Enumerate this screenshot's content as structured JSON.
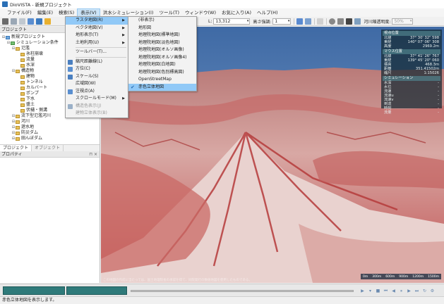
{
  "window": {
    "title": "DioVISTA - 新規プロジェクト"
  },
  "menubar": [
    {
      "label": "ファイル(F)"
    },
    {
      "label": "編集(E)"
    },
    {
      "label": "検索(S)"
    },
    {
      "label": "表示(V)"
    },
    {
      "label": "洪水シミュレーション(I)"
    },
    {
      "label": "ツール(T)"
    },
    {
      "label": "ウィンドウ(W)"
    },
    {
      "label": "お気に入り(A)"
    },
    {
      "label": "ヘルプ(H)"
    }
  ],
  "toolbar": {
    "l_label": "L:",
    "l_value": "13,312",
    "height_label": "高さ強調:",
    "height_value": "1",
    "transparency_label": "河川縮透明度:",
    "transparency_value": "50%"
  },
  "project_panel": {
    "title": "プロジェクト",
    "tree": [
      {
        "label": "新規プロジェクト",
        "level": 0,
        "kind": "proj"
      },
      {
        "label": "シミュレーション条件",
        "level": 1,
        "kind": "sim"
      },
      {
        "label": "氾濫",
        "level": 2,
        "kind": "folder"
      },
      {
        "label": "氷柱崩壊",
        "level": 3,
        "kind": "folder"
      },
      {
        "label": "流量",
        "level": 3,
        "kind": "folder"
      },
      {
        "label": "水深",
        "level": 3,
        "kind": "folder"
      },
      {
        "label": "構造物",
        "level": 2,
        "kind": "folder"
      },
      {
        "label": "建物",
        "level": 3,
        "kind": "folder"
      },
      {
        "label": "トンネル",
        "level": 3,
        "kind": "folder"
      },
      {
        "label": "カルバート",
        "level": 3,
        "kind": "folder"
      },
      {
        "label": "ポンプ",
        "level": 3,
        "kind": "folder"
      },
      {
        "label": "下水",
        "level": 3,
        "kind": "folder"
      },
      {
        "label": "盛土",
        "level": 3,
        "kind": "folder"
      },
      {
        "label": "伏樋・側溝",
        "level": 3,
        "kind": "folder"
      },
      {
        "label": "流下型氾濫河川",
        "level": 2,
        "kind": "folder"
      },
      {
        "label": "河川",
        "level": 2,
        "kind": "folder"
      },
      {
        "label": "遊水地",
        "level": 2,
        "kind": "folder"
      },
      {
        "label": "防災ダム",
        "level": 2,
        "kind": "folder"
      },
      {
        "label": "田んぼダム",
        "level": 2,
        "kind": "folder"
      }
    ]
  },
  "panel_tabs": [
    {
      "label": "プロジェクト"
    },
    {
      "label": "オブジェクト"
    }
  ],
  "property_panel": {
    "title": "プロパティ"
  },
  "view_menu": [
    {
      "label": "ラスタ地図(R)",
      "has_sub": true,
      "highlight": true
    },
    {
      "label": "ベクタ地図(V)",
      "has_sub": true
    },
    {
      "label": "地形表示(T)",
      "has_sub": true
    },
    {
      "label": "土地利用(U)",
      "has_sub": true
    },
    {
      "sep": true
    },
    {
      "label": "ツールバー(T)..."
    },
    {
      "sep": true
    },
    {
      "label": "縮尺距離線(L)",
      "icon": "#4a7fc0"
    },
    {
      "label": "方位(C)",
      "icon": "#5a8fd0"
    },
    {
      "label": "スケール(S)",
      "icon": "#4a7fc0"
    },
    {
      "label": "広域図(W)"
    },
    {
      "label": "注視点(A)",
      "icon": "#5a8fd0"
    },
    {
      "label": "スクロールモード(M)",
      "has_sub": true
    },
    {
      "label": "構造色表示(J)",
      "disabled": true,
      "icon": "#9ab0c8"
    },
    {
      "label": "建物立体表示(B)",
      "disabled": true
    }
  ],
  "raster_submenu": [
    {
      "label": "(非表示)"
    },
    {
      "label": "地形図"
    },
    {
      "label": "地理院地図(標準地図)"
    },
    {
      "label": "地理院地図(淡色地図)"
    },
    {
      "label": "地理院地図(オルソ画像)"
    },
    {
      "label": "地理院地図(オルソ画像4)"
    },
    {
      "label": "地理院地図(白地図)"
    },
    {
      "label": "地理院地図(色別標高図)"
    },
    {
      "label": "OpenStreetMap"
    },
    {
      "label": "赤色立体地図",
      "checked": true,
      "highlight": true
    }
  ],
  "info_panel": {
    "viewpoint_title": "視点位置",
    "viewpoint": [
      {
        "k": "北緯",
        "v": "37° 30' 32\" 598"
      },
      {
        "k": "東経",
        "v": "140° 07' 06\" 308"
      },
      {
        "k": "高度",
        "v": "2969.2m"
      }
    ],
    "mouse_title": "マウス位置",
    "mouse": [
      {
        "k": "北緯",
        "v": "37° 41' 26\" 767"
      },
      {
        "k": "東経",
        "v": "139° 45' 20\" 060"
      },
      {
        "k": "標高",
        "v": "468.3m"
      },
      {
        "k": "距離",
        "v": "351.41502m"
      },
      {
        "k": "縮尺",
        "v": "1:15026"
      }
    ],
    "sim_title": "シミュレーション",
    "sim": [
      {
        "k": "水深",
        "v": "-"
      },
      {
        "k": "水位",
        "v": "-"
      },
      {
        "k": "流速",
        "v": "-"
      },
      {
        "k": "流速u",
        "v": "-"
      },
      {
        "k": "流速v",
        "v": "-"
      },
      {
        "k": "到達",
        "v": "-"
      },
      {
        "k": "時刻",
        "v": "-"
      },
      {
        "k": "流量",
        "v": "-"
      }
    ]
  },
  "scale_labels": [
    "0m",
    "300m",
    "600m",
    "900m",
    "1200m",
    "1500m"
  ],
  "attribution": "この地図の作成に当たっては、国土地理院長の承認を得て、同院発行の数値地図を使用したものである。",
  "statusbar": {
    "text": "赤色立体地図を表示します。"
  }
}
